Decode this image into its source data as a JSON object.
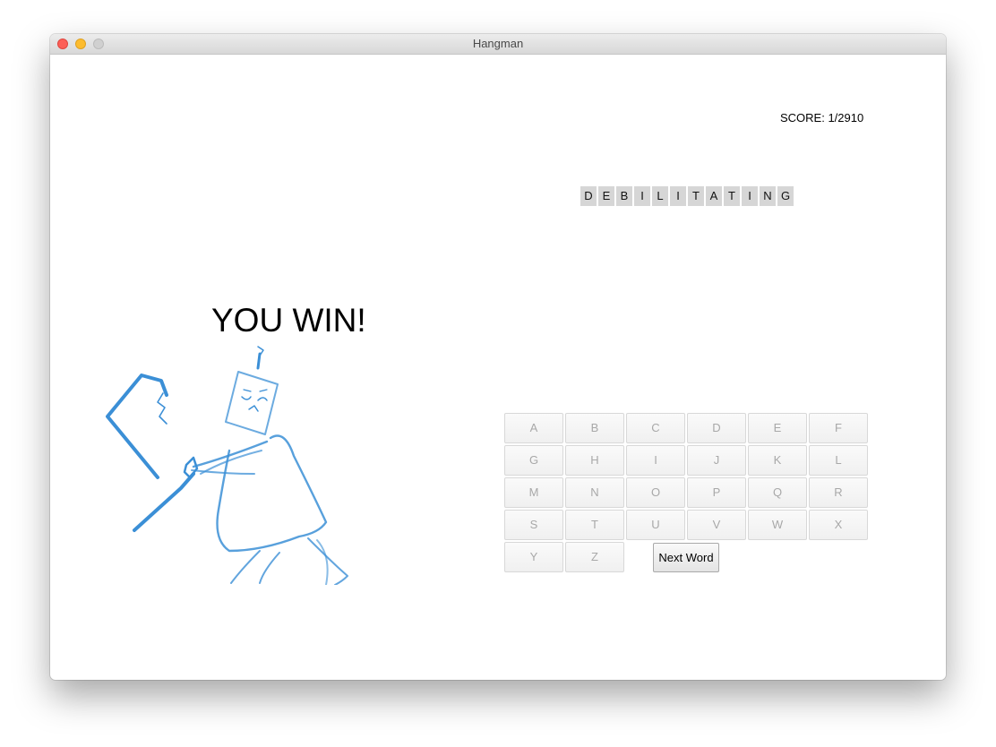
{
  "window": {
    "title": "Hangman"
  },
  "score": {
    "label": "SCORE: 1/2910"
  },
  "word": {
    "letters": [
      "D",
      "E",
      "B",
      "I",
      "L",
      "I",
      "T",
      "A",
      "T",
      "I",
      "N",
      "G"
    ]
  },
  "result": {
    "message": "YOU WIN!"
  },
  "keyboard": {
    "keys": [
      "A",
      "B",
      "C",
      "D",
      "E",
      "F",
      "G",
      "H",
      "I",
      "J",
      "K",
      "L",
      "M",
      "N",
      "O",
      "P",
      "Q",
      "R",
      "S",
      "T",
      "U",
      "V",
      "W",
      "X",
      "Y",
      "Z"
    ],
    "next_word_label": "Next Word"
  },
  "colors": {
    "stick_figure": "#3b8fd6",
    "tile_background": "#d6d6d6",
    "disabled_key_text": "#a8a8a8"
  },
  "icons": {
    "drawing": "hangman-figure-escaping"
  }
}
